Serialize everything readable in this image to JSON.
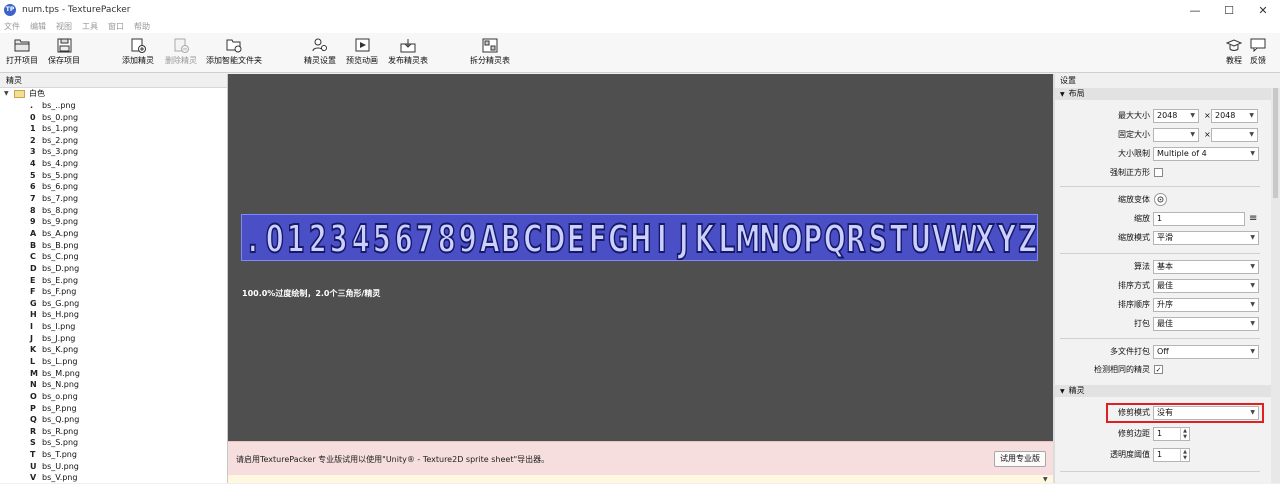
{
  "window": {
    "title": "num.tps - TexturePacker",
    "app_icon_text": "TP",
    "minimize": "—",
    "maximize": "☐",
    "close": "✕"
  },
  "menu": [
    "文件",
    "编辑",
    "视图",
    "工具",
    "窗口",
    "帮助"
  ],
  "toolbar": {
    "open": "打开项目",
    "save": "保存项目",
    "add_sprite": "添加精灵",
    "remove_sprite": "删除精灵",
    "add_smart_folder": "添加智能文件夹",
    "sprite_settings": "精灵设置",
    "preview_anim": "预览动画",
    "publish": "发布精灵表",
    "split": "拆分精灵表",
    "tutorial": "教程",
    "feedback": "反馈"
  },
  "sprites_panel": {
    "header": "精灵",
    "folder": "白色",
    "items": [
      {
        "glyph": ".",
        "name": "bs_..png"
      },
      {
        "glyph": "0",
        "name": "bs_0.png"
      },
      {
        "glyph": "1",
        "name": "bs_1.png"
      },
      {
        "glyph": "2",
        "name": "bs_2.png"
      },
      {
        "glyph": "3",
        "name": "bs_3.png"
      },
      {
        "glyph": "4",
        "name": "bs_4.png"
      },
      {
        "glyph": "5",
        "name": "bs_5.png"
      },
      {
        "glyph": "6",
        "name": "bs_6.png"
      },
      {
        "glyph": "7",
        "name": "bs_7.png"
      },
      {
        "glyph": "8",
        "name": "bs_8.png"
      },
      {
        "glyph": "9",
        "name": "bs_9.png"
      },
      {
        "glyph": "A",
        "name": "bs_A.png"
      },
      {
        "glyph": "B",
        "name": "bs_B.png"
      },
      {
        "glyph": "C",
        "name": "bs_C.png"
      },
      {
        "glyph": "D",
        "name": "bs_D.png"
      },
      {
        "glyph": "E",
        "name": "bs_E.png"
      },
      {
        "glyph": "F",
        "name": "bs_F.png"
      },
      {
        "glyph": "G",
        "name": "bs_G.png"
      },
      {
        "glyph": "H",
        "name": "bs_H.png"
      },
      {
        "glyph": "I",
        "name": "bs_I.png"
      },
      {
        "glyph": "J",
        "name": "bs_J.png"
      },
      {
        "glyph": "K",
        "name": "bs_K.png"
      },
      {
        "glyph": "L",
        "name": "bs_L.png"
      },
      {
        "glyph": "M",
        "name": "bs_M.png"
      },
      {
        "glyph": "N",
        "name": "bs_N.png"
      },
      {
        "glyph": "O",
        "name": "bs_o.png"
      },
      {
        "glyph": "P",
        "name": "bs_P.png"
      },
      {
        "glyph": "Q",
        "name": "bs_Q.png"
      },
      {
        "glyph": "R",
        "name": "bs_R.png"
      },
      {
        "glyph": "S",
        "name": "bs_S.png"
      },
      {
        "glyph": "T",
        "name": "bs_T.png"
      },
      {
        "glyph": "U",
        "name": "bs_U.png"
      },
      {
        "glyph": "V",
        "name": "bs_V.png"
      }
    ]
  },
  "canvas": {
    "glyphs": [
      ".",
      "0",
      "1",
      "2",
      "3",
      "4",
      "5",
      "6",
      "7",
      "8",
      "9",
      "A",
      "B",
      "C",
      "D",
      "E",
      "F",
      "G",
      "H",
      "I",
      "J",
      "K",
      "L",
      "M",
      "N",
      "O",
      "P",
      "Q",
      "R",
      "S",
      "T",
      "U",
      "V",
      "W",
      "X",
      "Y",
      "Z"
    ],
    "stats": "100.0%过度绘制，2.0个三角形/精灵",
    "notice": "请启用TexturePacker 专业版试用以使用\"Unity® - Texture2D sprite sheet\"导出器。",
    "try_pro": "试用专业版"
  },
  "settings": {
    "header": "设置",
    "layout_section": "布局",
    "max_size_label": "最大大小",
    "max_w": "2048",
    "max_h": "2048",
    "x_sep": "×",
    "fixed_size_label": "固定大小",
    "size_constraint_label": "大小限制",
    "size_constraint": "Multiple of 4",
    "force_square_label": "强制正方形",
    "scale_variant_label": "缩放变体",
    "scale_label": "缩放",
    "scale_value": "1",
    "scale_mode_label": "缩放模式",
    "scale_mode": "平滑",
    "algorithm_label": "算法",
    "algorithm": "基本",
    "sort_by_label": "排序方式",
    "sort_by": "最佳",
    "sort_order_label": "排序顺序",
    "sort_order": "升序",
    "pack_label": "打包",
    "pack": "最佳",
    "multipack_label": "多文件打包",
    "multipack": "Off",
    "detect_identical_label": "检测相同的精灵",
    "detect_identical_check": "✓",
    "sprites_section": "精灵",
    "trim_mode_label": "修剪模式",
    "trim_mode": "没有",
    "trim_margin_label": "修剪边距",
    "trim_margin": "1",
    "alpha_threshold_label": "透明度阈值",
    "alpha_threshold": "1"
  }
}
